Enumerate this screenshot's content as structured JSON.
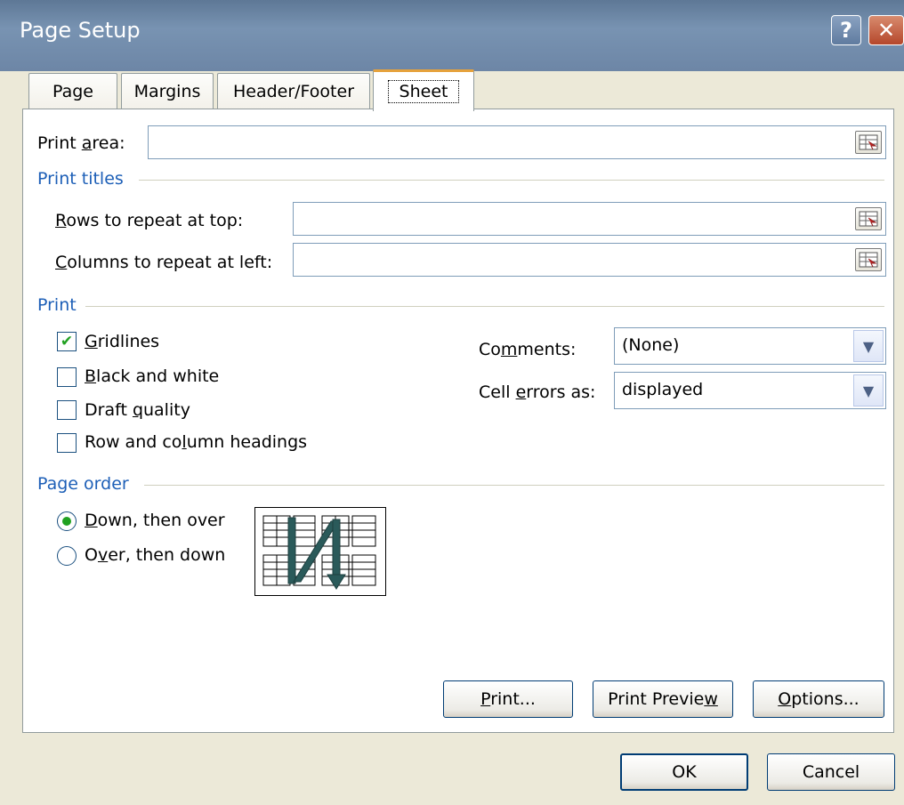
{
  "window": {
    "title": "Page Setup",
    "help_glyph": "?",
    "close_glyph": "✕"
  },
  "tabs": [
    {
      "label": "Page"
    },
    {
      "label": "Margins"
    },
    {
      "label": "Header/Footer"
    },
    {
      "label": "Sheet",
      "active": true
    }
  ],
  "print_area": {
    "label_pre": "Print ",
    "label_key": "a",
    "label_post": "rea:",
    "value": ""
  },
  "print_titles": {
    "heading": "Print titles",
    "rows": {
      "label_key": "R",
      "label_post": "ows to repeat at top:",
      "value": ""
    },
    "columns": {
      "label_key": "C",
      "label_post": "olumns to repeat at left:",
      "value": ""
    }
  },
  "print": {
    "heading": "Print",
    "gridlines": {
      "label_key": "G",
      "label_post": "ridlines",
      "checked": true
    },
    "black_white": {
      "label_key": "B",
      "label_post": "lack and white",
      "checked": false
    },
    "draft": {
      "label_pre": "Draft ",
      "label_key": "q",
      "label_post": "uality",
      "checked": false
    },
    "headings": {
      "label_pre": "Row and co",
      "label_key": "l",
      "label_post": "umn headings",
      "checked": false
    },
    "comments": {
      "label_pre": "Co",
      "label_key": "m",
      "label_post": "ments:",
      "value": "(None)"
    },
    "cell_errors": {
      "label_pre": "Cell ",
      "label_key": "e",
      "label_post": "rrors as:",
      "value": "displayed"
    }
  },
  "page_order": {
    "heading": "Page order",
    "down_then_over": {
      "label_key": "D",
      "label_post": "own, then over",
      "selected": true
    },
    "over_then_down": {
      "label_pre": "O",
      "label_key": "v",
      "label_post": "er, then down",
      "selected": false
    }
  },
  "panel_buttons": {
    "print": {
      "label_key": "P",
      "label_post": "rint..."
    },
    "preview": {
      "label_pre": "Print Previe",
      "label_key": "w",
      "label_post": ""
    },
    "options": {
      "label_key": "O",
      "label_post": "ptions..."
    }
  },
  "dialog_buttons": {
    "ok": "OK",
    "cancel": "Cancel"
  },
  "colors": {
    "group_heading": "#1d5fb7",
    "check": "#21a121",
    "titlebar": "#6d86a6"
  }
}
